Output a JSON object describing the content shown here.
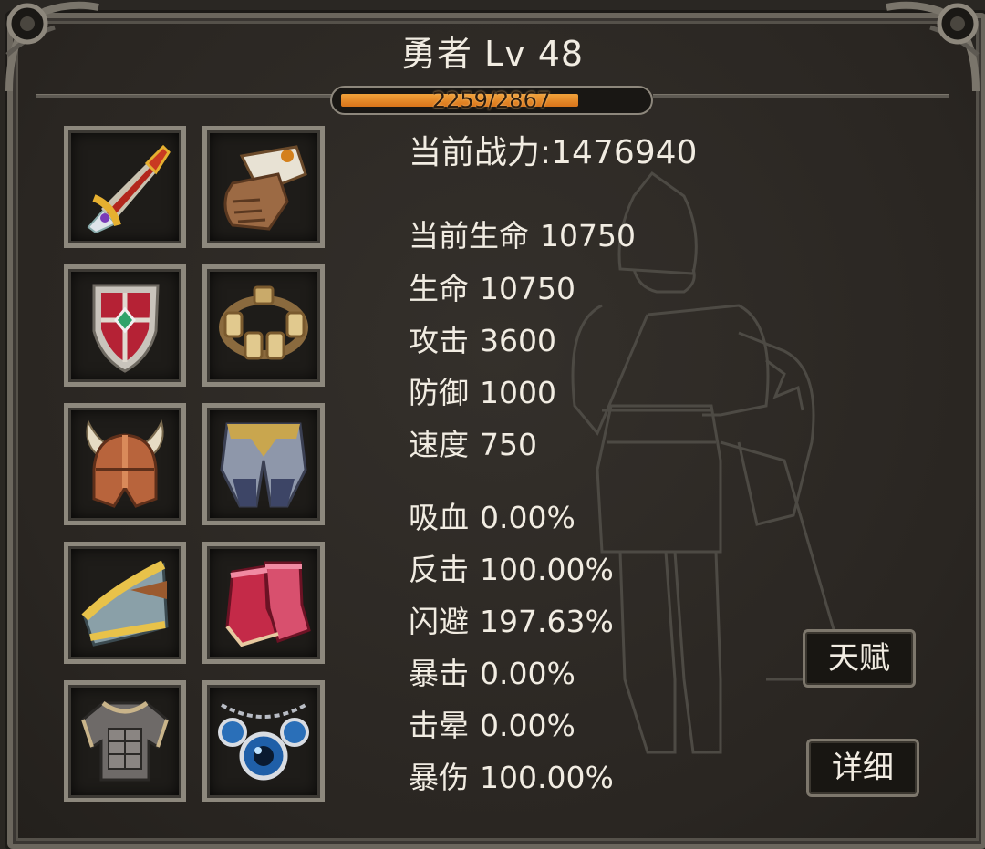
{
  "header": {
    "title": "勇者 Lv 48",
    "xp_text": "2259/2867",
    "xp_fraction": 0.788
  },
  "stats": {
    "power": "当前战力:1476940",
    "rows": [
      {
        "label": "当前生命",
        "value": "10750"
      },
      {
        "label": "生命",
        "value": "10750"
      },
      {
        "label": "攻击",
        "value": "3600"
      },
      {
        "label": "防御",
        "value": "1000"
      },
      {
        "label": "速度",
        "value": "750"
      },
      {
        "label": "吸血",
        "value": "0.00%"
      },
      {
        "label": "反击",
        "value": "100.00%"
      },
      {
        "label": "闪避",
        "value": "197.63%"
      },
      {
        "label": "暴击",
        "value": "0.00%"
      },
      {
        "label": "击晕",
        "value": "0.00%"
      },
      {
        "label": "暴伤",
        "value": "100.00%"
      }
    ]
  },
  "equipment": [
    {
      "icon": "sword-icon"
    },
    {
      "icon": "gauntlet-icon"
    },
    {
      "icon": "shield-icon"
    },
    {
      "icon": "bracelet-icon"
    },
    {
      "icon": "horned-helmet-icon"
    },
    {
      "icon": "leg-armor-icon"
    },
    {
      "icon": "shoulder-guard-icon"
    },
    {
      "icon": "boots-icon"
    },
    {
      "icon": "chest-armor-icon"
    },
    {
      "icon": "amulet-icon"
    }
  ],
  "buttons": {
    "talent": "天赋",
    "detail": "详细"
  },
  "colors": {
    "xp_fill": "#e08a22",
    "text": "#f1ece2",
    "frame": "#6b665d"
  }
}
